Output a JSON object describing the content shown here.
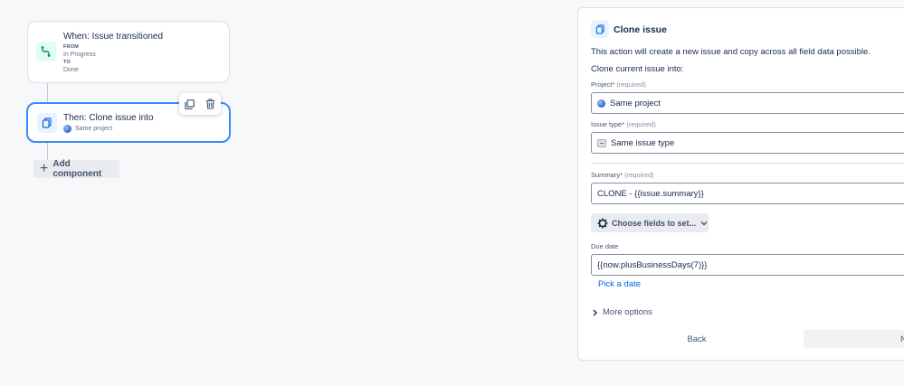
{
  "flow": {
    "trigger": {
      "title": "When: Issue transitioned",
      "from_label": "FROM",
      "from_value": "In Progress",
      "to_label": "TO",
      "to_value": "Done"
    },
    "action": {
      "title": "Then: Clone issue into",
      "project": "Same project"
    },
    "add_component_label": "Add component"
  },
  "panel": {
    "title": "Clone issue",
    "description": "This action will create a new issue and copy across all field data possible.",
    "clone_into_label": "Clone current issue into:",
    "project": {
      "label": "Project",
      "required_mark": "*",
      "hint": "(required)",
      "value": "Same project"
    },
    "issue_type": {
      "label": "Issue type",
      "required_mark": "*",
      "hint": "(required)",
      "value": "Same issue type"
    },
    "summary": {
      "label": "Summary",
      "required_mark": "*",
      "hint": "(required)",
      "value": "CLONE - {{issue.summary}}"
    },
    "choose_fields_label": "Choose fields to set...",
    "due_date": {
      "label": "Due date",
      "value": "{{now.plusBusinessDays(7)}}"
    },
    "pick_date_label": "Pick a date",
    "more_options_label": "More options",
    "back_label": "Back",
    "next_label": "N"
  },
  "colors": {
    "accent": "#388bff",
    "link": "#0c66e4",
    "trigger_icon": "#1f845a"
  }
}
